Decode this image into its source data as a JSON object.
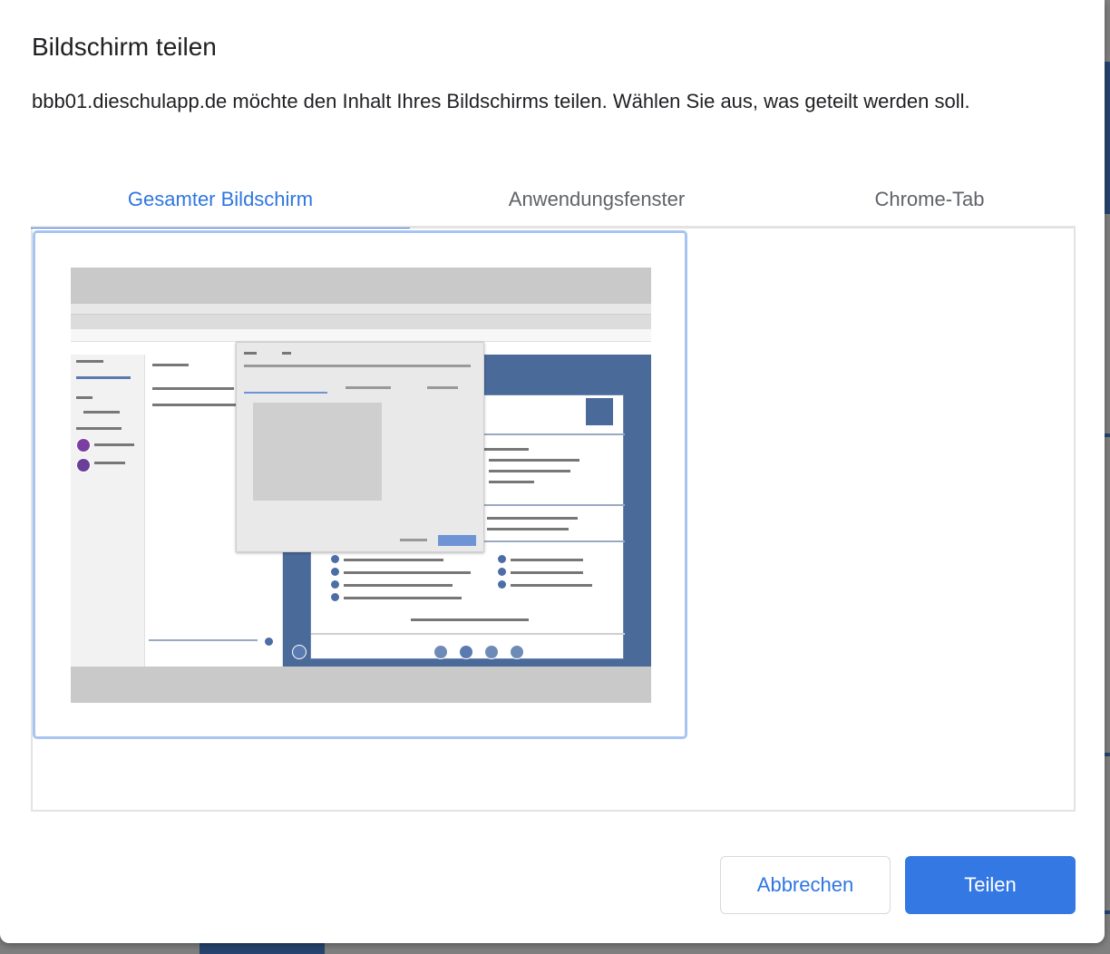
{
  "dialog": {
    "title": "Bildschirm teilen",
    "description": "bbb01.dieschulapp.de möchte den Inhalt Ihres Bildschirms teilen. Wählen Sie aus, was geteilt werden soll."
  },
  "tabs": [
    {
      "label": "Gesamter Bildschirm",
      "active": true
    },
    {
      "label": "Anwendungsfenster",
      "active": false
    },
    {
      "label": "Chrome-Tab",
      "active": false
    }
  ],
  "sources": [
    {
      "type": "screen-thumbnail",
      "selected": true
    }
  ],
  "buttons": {
    "cancel_label": "Abbrechen",
    "share_label": "Teilen"
  },
  "colors": {
    "accent": "#3478e4",
    "selected_border": "#a8c4f3"
  }
}
